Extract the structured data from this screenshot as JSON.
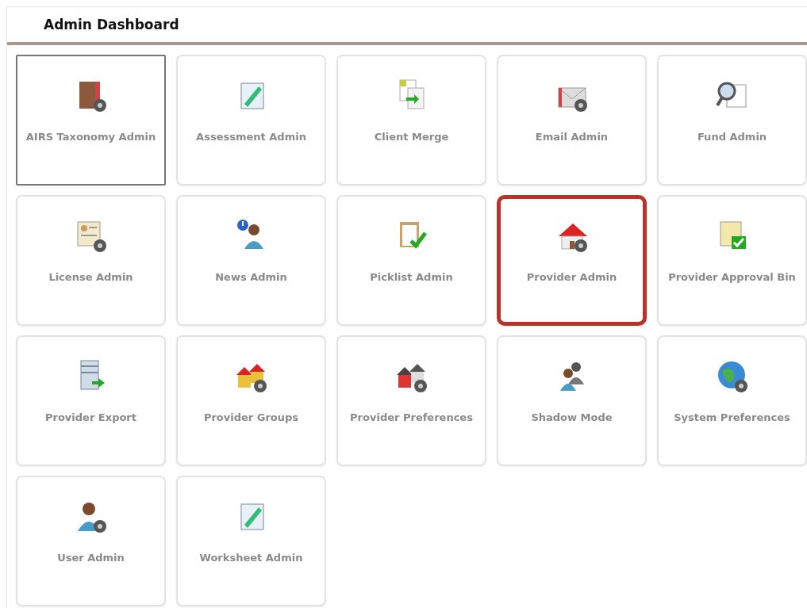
{
  "header": {
    "title": "Admin Dashboard"
  },
  "tiles": [
    {
      "label": "AIRS Taxonomy Admin",
      "focused": true,
      "highlighted": false
    },
    {
      "label": "Assessment Admin",
      "focused": false,
      "highlighted": false
    },
    {
      "label": "Client Merge",
      "focused": false,
      "highlighted": false
    },
    {
      "label": "Email Admin",
      "focused": false,
      "highlighted": false
    },
    {
      "label": "Fund Admin",
      "focused": false,
      "highlighted": false
    },
    {
      "label": "License Admin",
      "focused": false,
      "highlighted": false
    },
    {
      "label": "News Admin",
      "focused": false,
      "highlighted": false
    },
    {
      "label": "Picklist Admin",
      "focused": false,
      "highlighted": false
    },
    {
      "label": "Provider Admin",
      "focused": false,
      "highlighted": true
    },
    {
      "label": "Provider Approval Bin",
      "focused": false,
      "highlighted": false
    },
    {
      "label": "Provider Export",
      "focused": false,
      "highlighted": false
    },
    {
      "label": "Provider Groups",
      "focused": false,
      "highlighted": false
    },
    {
      "label": "Provider Preferences",
      "focused": false,
      "highlighted": false
    },
    {
      "label": "Shadow Mode",
      "focused": false,
      "highlighted": false
    },
    {
      "label": "System Preferences",
      "focused": false,
      "highlighted": false
    },
    {
      "label": "User Admin",
      "focused": false,
      "highlighted": false
    },
    {
      "label": "Worksheet Admin",
      "focused": false,
      "highlighted": false
    }
  ]
}
